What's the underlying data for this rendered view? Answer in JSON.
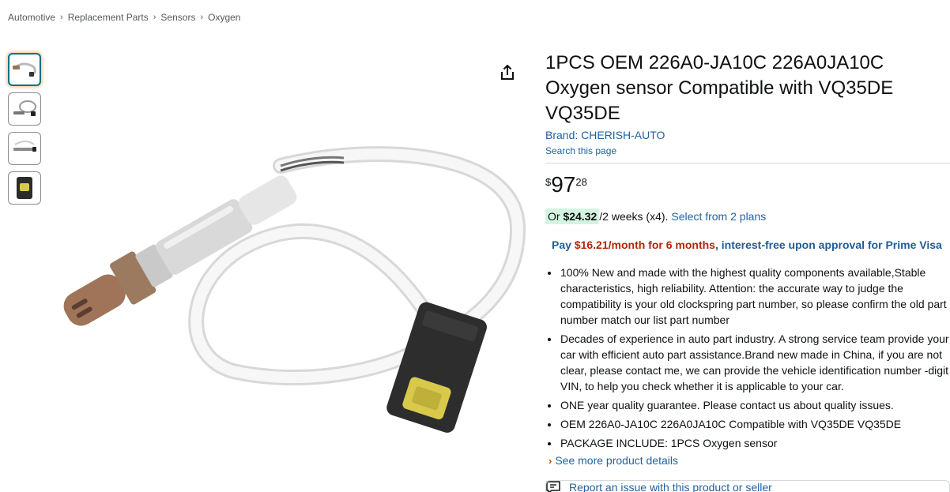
{
  "breadcrumb": [
    "Automotive",
    "Replacement Parts",
    "Sensors",
    "Oxygen"
  ],
  "breadcrumb_separator": "›",
  "thumbnails": [
    {
      "icon": "sensor-wire-thumbnail",
      "selected": true
    },
    {
      "icon": "sensor-coiled-thumbnail",
      "selected": false
    },
    {
      "icon": "sensor-side-thumbnail",
      "selected": false
    },
    {
      "icon": "connector-thumbnail",
      "selected": false
    }
  ],
  "share_icon": "share-icon",
  "product": {
    "title": "1PCS OEM 226A0-JA10C 226A0JA10C Oxygen sensor Compatible with VQ35DE VQ35DE",
    "brand": "Brand: CHERISH-AUTO",
    "search_page": "Search this page"
  },
  "price": {
    "symbol": "$",
    "whole": "97",
    "fraction": "28"
  },
  "installment": {
    "prefix": "Or ",
    "amount": "$24.32",
    "rest": "/2 weeks (x4).",
    "plans_link": "Select from 2 plans"
  },
  "promo": {
    "pay": "Pay ",
    "amount": "$16.21/month for 6 months",
    "rest": ", interest-free upon approval for Prime Visa"
  },
  "bullets": [
    "100% New and made with the highest quality components available,Stable characteristics, high reliability. Attention: the accurate way to judge the compatibility is your old clockspring part number, so please confirm the old part number match our list part number",
    "Decades of experience in auto part industry. A strong service team provide your car with efficient auto part assistance.Brand new made in China, if you are not clear, please contact me, we can provide the vehicle identification number -digit VIN, to help you check whether it is applicable to your car.",
    "ONE year quality guarantee. Please contact us about quality issues.",
    "OEM 226A0-JA10C 226A0JA10C Compatible with VQ35DE VQ35DE",
    "PACKAGE INCLUDE: 1PCS Oxygen sensor"
  ],
  "see_more": "See more product details",
  "report": "Report an issue with this product or seller",
  "colors": {
    "link": "#2162a1",
    "price_red": "#b12704",
    "installment_bg": "#d4f4e2",
    "thumb_selected": "#007185",
    "chevron": "#c45500"
  }
}
